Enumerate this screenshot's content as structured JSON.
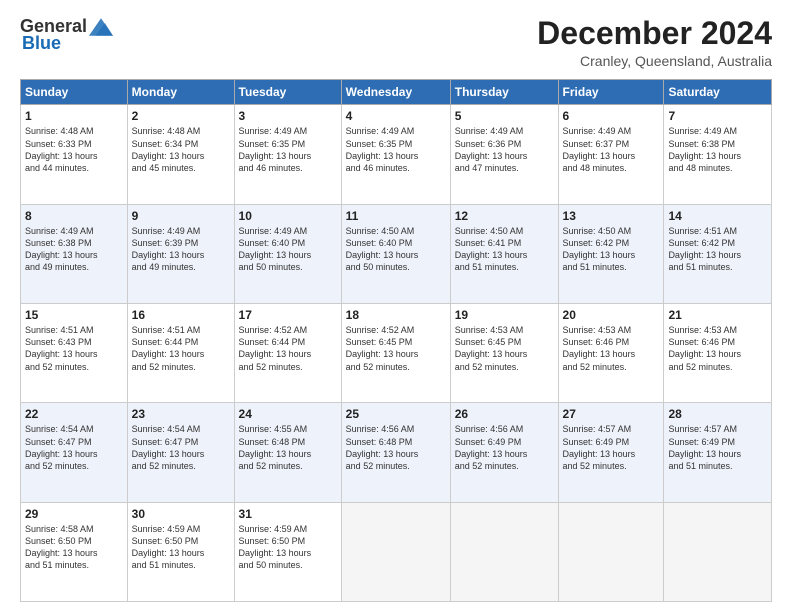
{
  "header": {
    "logo_general": "General",
    "logo_blue": "Blue",
    "month": "December 2024",
    "location": "Cranley, Queensland, Australia"
  },
  "weekdays": [
    "Sunday",
    "Monday",
    "Tuesday",
    "Wednesday",
    "Thursday",
    "Friday",
    "Saturday"
  ],
  "weeks": [
    [
      {
        "day": "1",
        "lines": [
          "Sunrise: 4:48 AM",
          "Sunset: 6:33 PM",
          "Daylight: 13 hours",
          "and 44 minutes."
        ]
      },
      {
        "day": "2",
        "lines": [
          "Sunrise: 4:48 AM",
          "Sunset: 6:34 PM",
          "Daylight: 13 hours",
          "and 45 minutes."
        ]
      },
      {
        "day": "3",
        "lines": [
          "Sunrise: 4:49 AM",
          "Sunset: 6:35 PM",
          "Daylight: 13 hours",
          "and 46 minutes."
        ]
      },
      {
        "day": "4",
        "lines": [
          "Sunrise: 4:49 AM",
          "Sunset: 6:35 PM",
          "Daylight: 13 hours",
          "and 46 minutes."
        ]
      },
      {
        "day": "5",
        "lines": [
          "Sunrise: 4:49 AM",
          "Sunset: 6:36 PM",
          "Daylight: 13 hours",
          "and 47 minutes."
        ]
      },
      {
        "day": "6",
        "lines": [
          "Sunrise: 4:49 AM",
          "Sunset: 6:37 PM",
          "Daylight: 13 hours",
          "and 48 minutes."
        ]
      },
      {
        "day": "7",
        "lines": [
          "Sunrise: 4:49 AM",
          "Sunset: 6:38 PM",
          "Daylight: 13 hours",
          "and 48 minutes."
        ]
      }
    ],
    [
      {
        "day": "8",
        "lines": [
          "Sunrise: 4:49 AM",
          "Sunset: 6:38 PM",
          "Daylight: 13 hours",
          "and 49 minutes."
        ]
      },
      {
        "day": "9",
        "lines": [
          "Sunrise: 4:49 AM",
          "Sunset: 6:39 PM",
          "Daylight: 13 hours",
          "and 49 minutes."
        ]
      },
      {
        "day": "10",
        "lines": [
          "Sunrise: 4:49 AM",
          "Sunset: 6:40 PM",
          "Daylight: 13 hours",
          "and 50 minutes."
        ]
      },
      {
        "day": "11",
        "lines": [
          "Sunrise: 4:50 AM",
          "Sunset: 6:40 PM",
          "Daylight: 13 hours",
          "and 50 minutes."
        ]
      },
      {
        "day": "12",
        "lines": [
          "Sunrise: 4:50 AM",
          "Sunset: 6:41 PM",
          "Daylight: 13 hours",
          "and 51 minutes."
        ]
      },
      {
        "day": "13",
        "lines": [
          "Sunrise: 4:50 AM",
          "Sunset: 6:42 PM",
          "Daylight: 13 hours",
          "and 51 minutes."
        ]
      },
      {
        "day": "14",
        "lines": [
          "Sunrise: 4:51 AM",
          "Sunset: 6:42 PM",
          "Daylight: 13 hours",
          "and 51 minutes."
        ]
      }
    ],
    [
      {
        "day": "15",
        "lines": [
          "Sunrise: 4:51 AM",
          "Sunset: 6:43 PM",
          "Daylight: 13 hours",
          "and 52 minutes."
        ]
      },
      {
        "day": "16",
        "lines": [
          "Sunrise: 4:51 AM",
          "Sunset: 6:44 PM",
          "Daylight: 13 hours",
          "and 52 minutes."
        ]
      },
      {
        "day": "17",
        "lines": [
          "Sunrise: 4:52 AM",
          "Sunset: 6:44 PM",
          "Daylight: 13 hours",
          "and 52 minutes."
        ]
      },
      {
        "day": "18",
        "lines": [
          "Sunrise: 4:52 AM",
          "Sunset: 6:45 PM",
          "Daylight: 13 hours",
          "and 52 minutes."
        ]
      },
      {
        "day": "19",
        "lines": [
          "Sunrise: 4:53 AM",
          "Sunset: 6:45 PM",
          "Daylight: 13 hours",
          "and 52 minutes."
        ]
      },
      {
        "day": "20",
        "lines": [
          "Sunrise: 4:53 AM",
          "Sunset: 6:46 PM",
          "Daylight: 13 hours",
          "and 52 minutes."
        ]
      },
      {
        "day": "21",
        "lines": [
          "Sunrise: 4:53 AM",
          "Sunset: 6:46 PM",
          "Daylight: 13 hours",
          "and 52 minutes."
        ]
      }
    ],
    [
      {
        "day": "22",
        "lines": [
          "Sunrise: 4:54 AM",
          "Sunset: 6:47 PM",
          "Daylight: 13 hours",
          "and 52 minutes."
        ]
      },
      {
        "day": "23",
        "lines": [
          "Sunrise: 4:54 AM",
          "Sunset: 6:47 PM",
          "Daylight: 13 hours",
          "and 52 minutes."
        ]
      },
      {
        "day": "24",
        "lines": [
          "Sunrise: 4:55 AM",
          "Sunset: 6:48 PM",
          "Daylight: 13 hours",
          "and 52 minutes."
        ]
      },
      {
        "day": "25",
        "lines": [
          "Sunrise: 4:56 AM",
          "Sunset: 6:48 PM",
          "Daylight: 13 hours",
          "and 52 minutes."
        ]
      },
      {
        "day": "26",
        "lines": [
          "Sunrise: 4:56 AM",
          "Sunset: 6:49 PM",
          "Daylight: 13 hours",
          "and 52 minutes."
        ]
      },
      {
        "day": "27",
        "lines": [
          "Sunrise: 4:57 AM",
          "Sunset: 6:49 PM",
          "Daylight: 13 hours",
          "and 52 minutes."
        ]
      },
      {
        "day": "28",
        "lines": [
          "Sunrise: 4:57 AM",
          "Sunset: 6:49 PM",
          "Daylight: 13 hours",
          "and 51 minutes."
        ]
      }
    ],
    [
      {
        "day": "29",
        "lines": [
          "Sunrise: 4:58 AM",
          "Sunset: 6:50 PM",
          "Daylight: 13 hours",
          "and 51 minutes."
        ]
      },
      {
        "day": "30",
        "lines": [
          "Sunrise: 4:59 AM",
          "Sunset: 6:50 PM",
          "Daylight: 13 hours",
          "and 51 minutes."
        ]
      },
      {
        "day": "31",
        "lines": [
          "Sunrise: 4:59 AM",
          "Sunset: 6:50 PM",
          "Daylight: 13 hours",
          "and 50 minutes."
        ]
      },
      {
        "day": "",
        "lines": []
      },
      {
        "day": "",
        "lines": []
      },
      {
        "day": "",
        "lines": []
      },
      {
        "day": "",
        "lines": []
      }
    ]
  ]
}
